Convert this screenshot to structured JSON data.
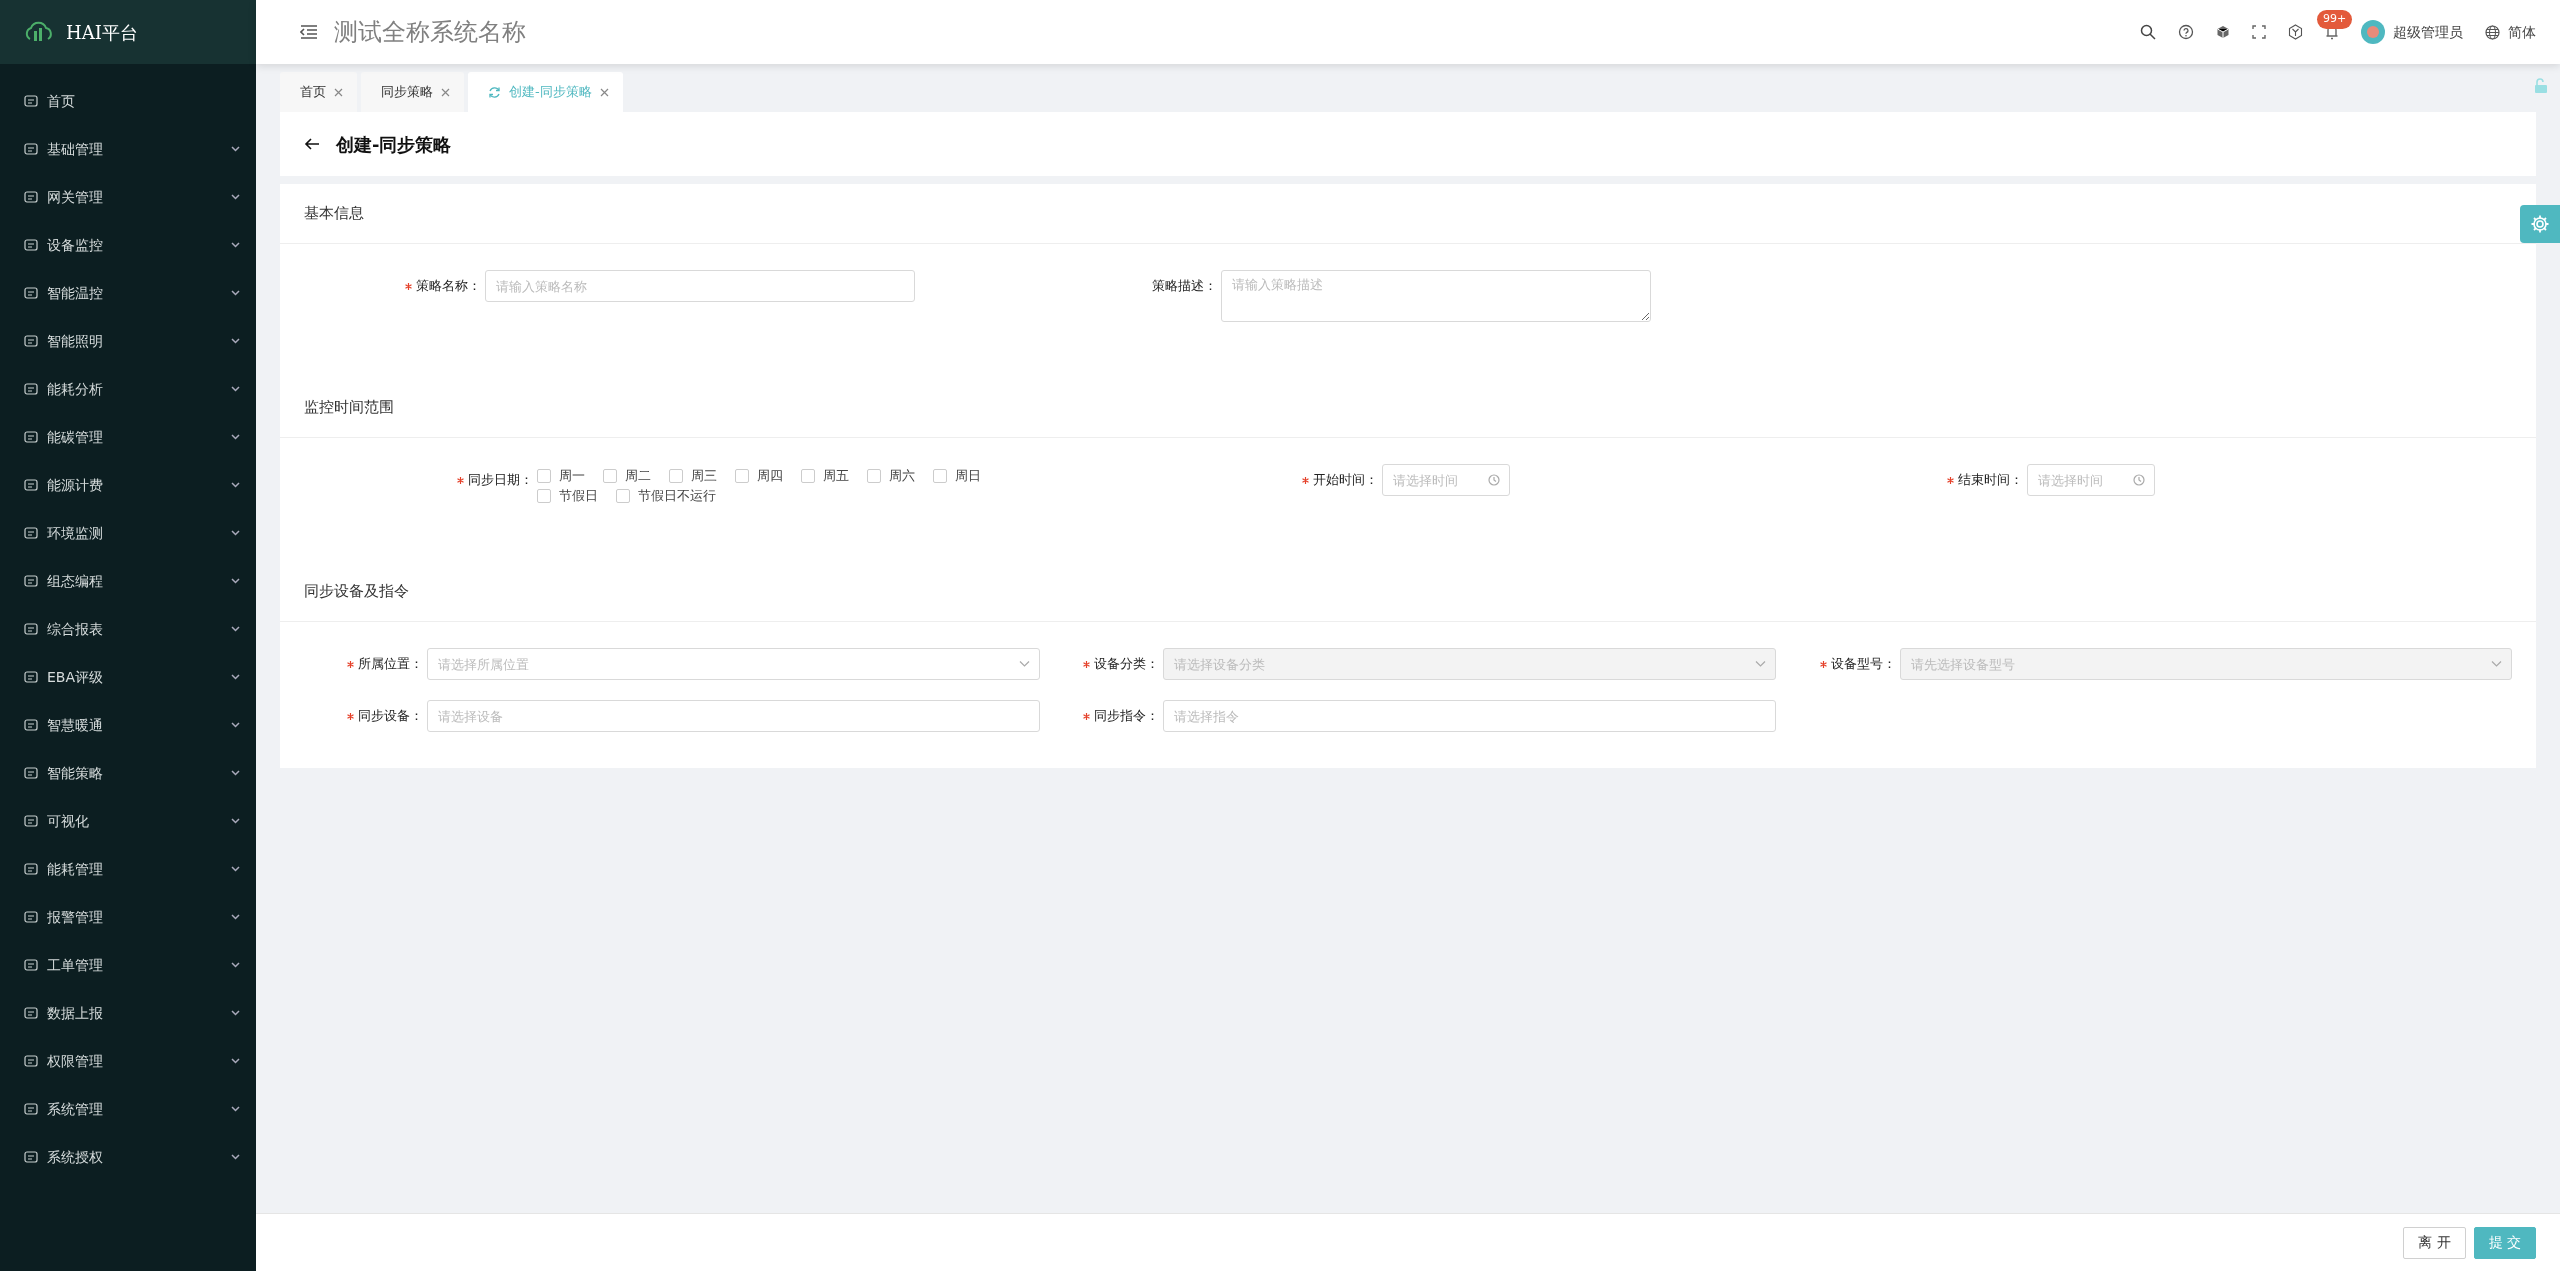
{
  "sidebar": {
    "logo": "HAI平台",
    "items": [
      {
        "label": "首页",
        "has_children": false
      },
      {
        "label": "基础管理",
        "has_children": true
      },
      {
        "label": "网关管理",
        "has_children": true
      },
      {
        "label": "设备监控",
        "has_children": true
      },
      {
        "label": "智能温控",
        "has_children": true
      },
      {
        "label": "智能照明",
        "has_children": true
      },
      {
        "label": "能耗分析",
        "has_children": true
      },
      {
        "label": "能碳管理",
        "has_children": true
      },
      {
        "label": "能源计费",
        "has_children": true
      },
      {
        "label": "环境监测",
        "has_children": true
      },
      {
        "label": "组态编程",
        "has_children": true
      },
      {
        "label": "综合报表",
        "has_children": true
      },
      {
        "label": "EBA评级",
        "has_children": true
      },
      {
        "label": "智慧暖通",
        "has_children": true
      },
      {
        "label": "智能策略",
        "has_children": true
      },
      {
        "label": "可视化",
        "has_children": true
      },
      {
        "label": "能耗管理",
        "has_children": true
      },
      {
        "label": "报警管理",
        "has_children": true
      },
      {
        "label": "工单管理",
        "has_children": true
      },
      {
        "label": "数据上报",
        "has_children": true
      },
      {
        "label": "权限管理",
        "has_children": true
      },
      {
        "label": "系统管理",
        "has_children": true
      },
      {
        "label": "系统授权",
        "has_children": true
      }
    ]
  },
  "header": {
    "title": "测试全称系统名称",
    "notification_badge": "99+",
    "user": "超级管理员",
    "language": "简体"
  },
  "tabs": [
    {
      "label": "首页",
      "selected": false
    },
    {
      "label": "同步策略",
      "selected": false
    },
    {
      "label": "创建-同步策略",
      "selected": true
    }
  ],
  "page_title": "创建-同步策略",
  "sections": [
    {
      "title": "基本信息",
      "fields": [
        {
          "kind": "input",
          "label": "策略名称：",
          "required": true,
          "placeholder": "请输入策略名称",
          "disabled": false
        },
        {
          "kind": "textarea",
          "label": "策略描述：",
          "required": false,
          "placeholder": "请输入策略描述",
          "disabled": false
        }
      ]
    },
    {
      "title": "监控时间范围",
      "fields": [
        {
          "kind": "checkboxes",
          "label": "同步日期：",
          "required": true,
          "options": [
            {
              "label": "周一",
              "checked": false
            },
            {
              "label": "周二",
              "checked": false
            },
            {
              "label": "周三",
              "checked": false
            },
            {
              "label": "周四",
              "checked": false
            },
            {
              "label": "周五",
              "checked": false
            },
            {
              "label": "周六",
              "checked": false
            },
            {
              "label": "周日",
              "checked": false
            },
            {
              "label": "节假日",
              "checked": false
            },
            {
              "label": "节假日不运行",
              "checked": false
            }
          ]
        },
        {
          "kind": "time",
          "label": "开始时间：",
          "required": true,
          "placeholder": "请选择时间",
          "disabled": false
        },
        {
          "kind": "time",
          "label": "结束时间：",
          "required": true,
          "placeholder": "请选择时间",
          "disabled": false
        }
      ]
    },
    {
      "title": "同步设备及指令",
      "fields": [
        {
          "kind": "select",
          "label": "所属位置：",
          "required": true,
          "placeholder": "请选择所属位置",
          "disabled": false
        },
        {
          "kind": "select",
          "label": "设备分类：",
          "required": true,
          "placeholder": "请选择设备分类",
          "disabled": true
        },
        {
          "kind": "select",
          "label": "设备型号：",
          "required": true,
          "placeholder": "请先选择设备型号",
          "disabled": true
        },
        {
          "kind": "input",
          "label": "同步设备：",
          "required": true,
          "placeholder": "请选择设备",
          "disabled": false
        },
        {
          "kind": "input",
          "label": "同步指令：",
          "required": true,
          "placeholder": "请选择指令",
          "disabled": false
        }
      ]
    }
  ],
  "footer_buttons": [
    {
      "label": "离 开",
      "kind": "secondary"
    },
    {
      "label": "提 交",
      "kind": "primary"
    }
  ]
}
